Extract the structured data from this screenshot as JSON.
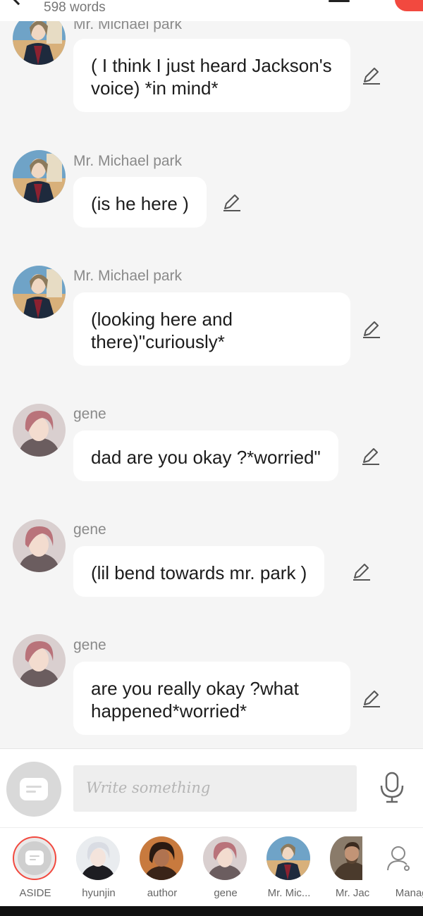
{
  "header": {
    "word_count": "598 words",
    "back_icon": "back-arrow-icon",
    "list_icon": "list-icon"
  },
  "messages": [
    {
      "sender": "Mr. Michael park",
      "text": "( I think I just heard Jackson's voice) *in mind*",
      "avatar": "michael"
    },
    {
      "sender": "Mr. Michael park",
      "text": "(is he here )",
      "avatar": "michael"
    },
    {
      "sender": "Mr. Michael park",
      "text": "(looking here and there)\"curiously*",
      "avatar": "michael"
    },
    {
      "sender": "gene",
      "text": "dad are you okay ?*worried\"",
      "avatar": "gene"
    },
    {
      "sender": "gene",
      "text": "(lil bend towards mr. park )",
      "avatar": "gene"
    },
    {
      "sender": "gene",
      "text": "are you really okay ?what happened*worried*",
      "avatar": "gene"
    }
  ],
  "composer": {
    "placeholder": "Write something",
    "aside_icon": "chat-bubble-icon",
    "mic_icon": "microphone-icon"
  },
  "characters": [
    {
      "label": "ASIDE",
      "selected": true
    },
    {
      "label": "hyunjin"
    },
    {
      "label": "author"
    },
    {
      "label": "gene"
    },
    {
      "label": "Mr. Mic..."
    },
    {
      "label": "Mr. Jac"
    },
    {
      "label": "Manage"
    }
  ],
  "colors": {
    "accent": "#f2493f",
    "background": "#f5f5f5",
    "bubble": "#ffffff"
  }
}
